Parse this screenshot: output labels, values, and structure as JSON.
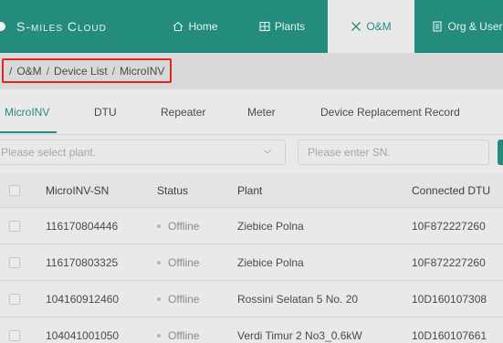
{
  "brand": {
    "name": "S-miles Cloud"
  },
  "nav": [
    {
      "label": "Home",
      "icon": "home-icon"
    },
    {
      "label": "Plants",
      "icon": "grid-icon"
    },
    {
      "label": "O&M",
      "icon": "tools-icon",
      "active": true
    },
    {
      "label": "Org & User",
      "icon": "document-icon"
    }
  ],
  "breadcrumb": {
    "lead": "/",
    "items": [
      "O&M",
      "Device List",
      "MicroINV"
    ],
    "separator": "/"
  },
  "tabs": [
    {
      "label": "MicroINV",
      "active": true
    },
    {
      "label": "DTU"
    },
    {
      "label": "Repeater"
    },
    {
      "label": "Meter"
    },
    {
      "label": "Device Replacement Record"
    }
  ],
  "filters": {
    "plant_placeholder": "Please select plant.",
    "sn_placeholder": "Please enter SN."
  },
  "table": {
    "headers": [
      "MicroINV-SN",
      "Status",
      "Plant",
      "Connected DTU"
    ],
    "rows": [
      {
        "sn": "116170804446",
        "status": "Offline",
        "plant": "Ziebice Polna",
        "dtu": "10F872227260"
      },
      {
        "sn": "116170803325",
        "status": "Offline",
        "plant": "Ziebice Polna",
        "dtu": "10F872227260"
      },
      {
        "sn": "104160912460",
        "status": "Offline",
        "plant": "Rossini Selatan 5 No. 20",
        "dtu": "10D160107308"
      },
      {
        "sn": "104041001050",
        "status": "Offline",
        "plant": "Verdi Timur 2 No3_0.6kW",
        "dtu": "10D160107661"
      }
    ]
  },
  "colors": {
    "accent": "#238c7c",
    "highlight_box": "#e02525",
    "status_offline": "#b5b5b5"
  }
}
